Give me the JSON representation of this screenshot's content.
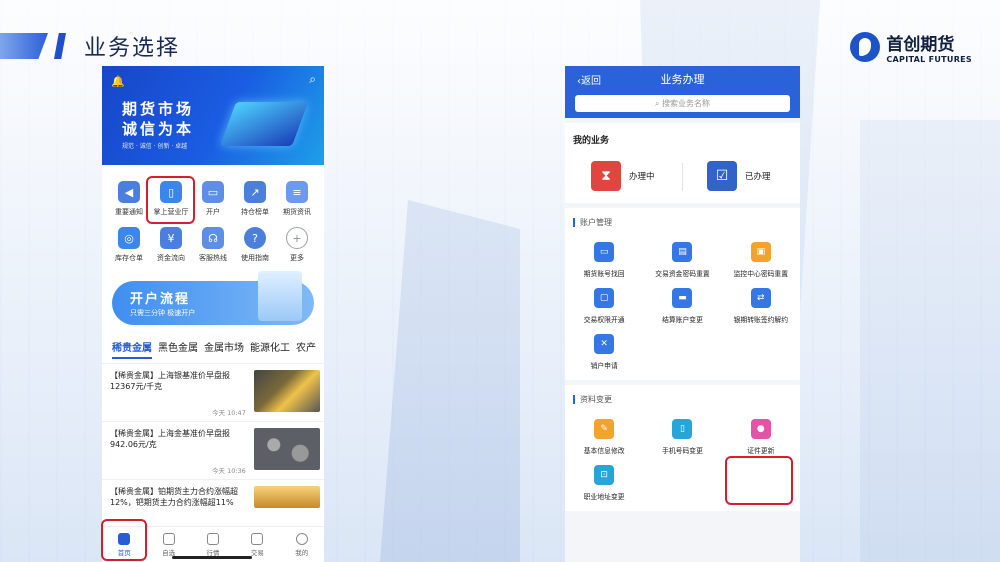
{
  "slide": {
    "title": "业务选择",
    "logo_cn": "首创期货",
    "logo_en": "CAPITAL FUTURES"
  },
  "left_app": {
    "banner": {
      "line1": "期货市场",
      "line2": "诚信为本",
      "tagline": "规范 · 诚信 · 创新 · 卓越"
    },
    "grid": [
      {
        "label": "重要通知",
        "icon": "megaphone-icon"
      },
      {
        "label": "掌上营业厅",
        "icon": "phone-icon"
      },
      {
        "label": "开户",
        "icon": "id-card-icon"
      },
      {
        "label": "持仓榜单",
        "icon": "chart-icon"
      },
      {
        "label": "期货资讯",
        "icon": "document-icon"
      },
      {
        "label": "库存仓单",
        "icon": "coins-icon"
      },
      {
        "label": "资金流向",
        "icon": "money-bag-icon"
      },
      {
        "label": "客服热线",
        "icon": "headset-icon"
      },
      {
        "label": "使用指南",
        "icon": "question-icon"
      },
      {
        "label": "更多",
        "icon": "plus-icon"
      }
    ],
    "promo": {
      "title": "开户流程",
      "subtitle": "只需三分钟   极速开户"
    },
    "tabs": [
      "稀贵金属",
      "黑色金属",
      "金属市场",
      "能源化工",
      "农产"
    ],
    "news": [
      {
        "text": "【稀贵金属】上海银基准价早盘报12367元/千克",
        "time": "今天 10:47"
      },
      {
        "text": "【稀贵金属】上海金基准价早盘报942.06元/克",
        "time": "今天 10:36"
      },
      {
        "text": "【稀贵金属】铂期货主力合约涨幅超12%，钯期货主力合约涨幅超11%",
        "time": ""
      }
    ],
    "nav": [
      "首页",
      "自选",
      "行情",
      "交易",
      "我的"
    ]
  },
  "right_app": {
    "back": "返回",
    "title": "业务办理",
    "search_placeholder": "搜索业务名称",
    "my_business": {
      "heading": "我的业务",
      "items": [
        "办理中",
        "已办理"
      ]
    },
    "account_section": {
      "heading": "账户管理",
      "items": [
        "期货账号找回",
        "交易资金密码重置",
        "监控中心密码重置",
        "交易权限开通",
        "结算账户变更",
        "银期转账签约解约",
        "销户申请"
      ]
    },
    "info_section": {
      "heading": "资料变更",
      "items": [
        "基本信息修改",
        "手机号码变更",
        "证件更新",
        "职业地址变更"
      ]
    }
  }
}
